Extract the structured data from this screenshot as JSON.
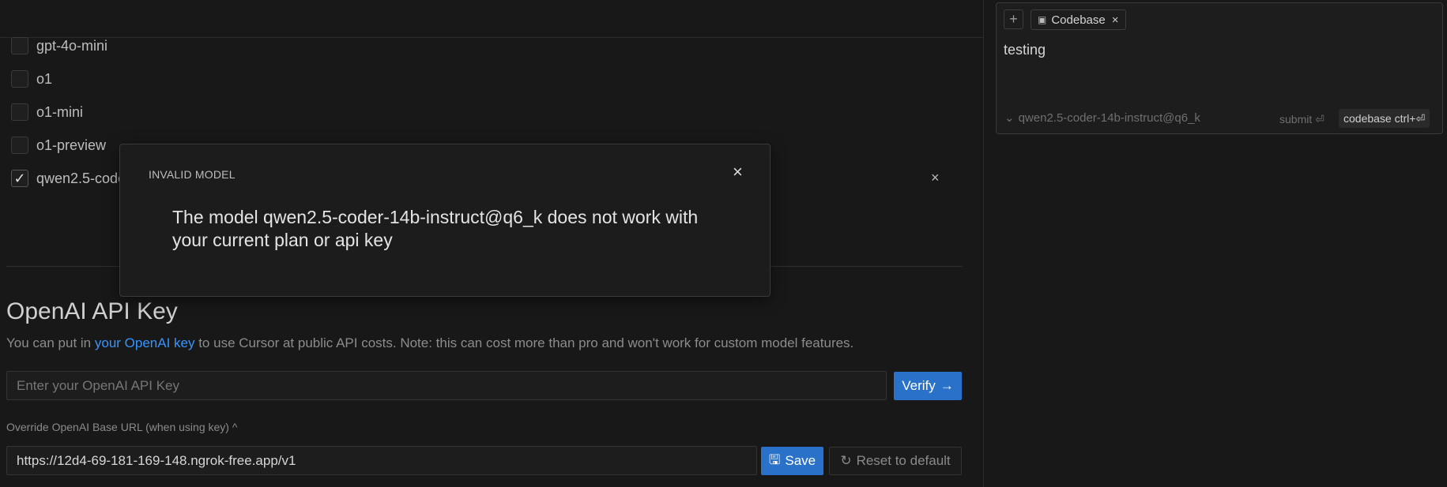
{
  "models": {
    "items": [
      {
        "label": "gpt-4o-mini",
        "checked": false
      },
      {
        "label": "o1",
        "checked": false
      },
      {
        "label": "o1-mini",
        "checked": false
      },
      {
        "label": "o1-preview",
        "checked": false
      },
      {
        "label": "qwen2.5-code",
        "checked": true
      }
    ],
    "check_glyph": "✓",
    "row_close_glyph": "×"
  },
  "modal": {
    "title": "INVALID MODEL",
    "close_glyph": "×",
    "message": "The model qwen2.5-coder-14b-instruct@q6_k does not work with your current plan or api key"
  },
  "api_key_section": {
    "title": "OpenAI API Key",
    "desc_prefix": "You can put in ",
    "desc_link": "your OpenAI key",
    "desc_suffix": " to use Cursor at public API costs. Note: this can cost more than pro and won't work for custom model features.",
    "input_placeholder": "Enter your OpenAI API Key",
    "verify_label": "Verify",
    "verify_icon": "→",
    "override_label": "Override OpenAI Base URL (when using key)",
    "override_icon": "^",
    "base_url_value": "https://12d4-69-181-169-148.ngrok-free.app/v1",
    "save_label": "Save",
    "save_icon": "🖫",
    "reset_label": "Reset to default",
    "reset_icon": "↻"
  },
  "chat": {
    "add_glyph": "+",
    "context_chip_label": "Codebase",
    "context_chip_icon": "▣",
    "context_chip_close": "×",
    "text": "testing",
    "model_chevron": "⌄",
    "model_name": "qwen2.5-coder-14b-instruct@q6_k",
    "submit_label": "submit ⏎",
    "codebase_shortcut": "codebase ctrl+⏎"
  },
  "colors": {
    "background": "#181818",
    "accent": "#2a72c9",
    "link": "#3794ff"
  }
}
